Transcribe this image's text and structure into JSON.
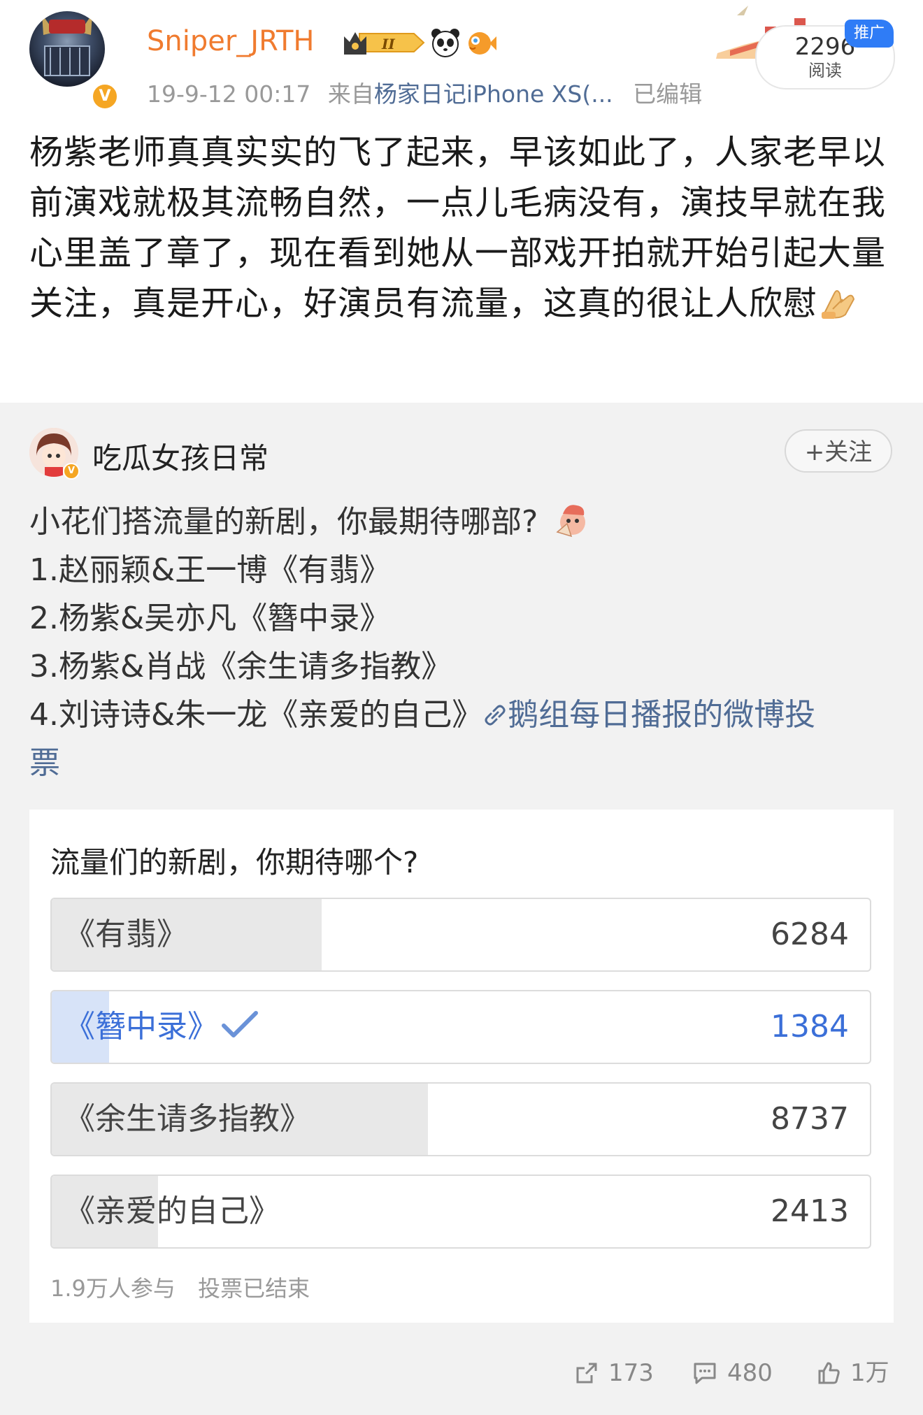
{
  "post": {
    "username": "Sniper_JRTH",
    "timestamp": "19-9-12 00:17",
    "source_prefix": "来自",
    "source": "杨家日记iPhone XS(...",
    "edited": "已编辑",
    "read_count": "2296",
    "read_label": "阅读",
    "promo_label": "推广",
    "level_badge": "II",
    "text": "杨紫老师真真实实的飞了起来，早该如此了，人家老早以前演戏就极其流畅自然，一点儿毛病没有，演技早就在我心里盖了章了，现在看到她从一部戏开拍就开始引起大量关注，真是开心，好演员有流量，这真的很让人欣慰",
    "icons": [
      "crown-level-badge-icon",
      "panda-icon",
      "pufferfish-icon",
      "folded-hands-emoji-icon",
      "verified-v-icon"
    ]
  },
  "repost": {
    "username": "吃瓜女孩日常",
    "follow_label": "+关注",
    "lines": [
      "小花们搭流量的新剧，你最期待哪部?",
      "1.赵丽颖&王一博《有翡》",
      "2.杨紫&吴亦凡《簪中录》",
      "3.杨紫&肖战《余生请多指教》",
      "4.刘诗诗&朱一龙《亲爱的自己》"
    ],
    "link_text_1": "鹅组每日播报的微博投",
    "link_text_2": "票"
  },
  "poll": {
    "title": "流量们的新剧，你期待哪个?",
    "options": [
      {
        "label": "《有翡》",
        "count": "6284",
        "fraction": 0.33,
        "selected": false
      },
      {
        "label": "《簪中录》",
        "count": "1384",
        "fraction": 0.07,
        "selected": true
      },
      {
        "label": "《余生请多指教》",
        "count": "8737",
        "fraction": 0.46,
        "selected": false
      },
      {
        "label": "《亲爱的自己》",
        "count": "2413",
        "fraction": 0.13,
        "selected": false
      }
    ],
    "participants": "1.9万人参与",
    "status": "投票已结束"
  },
  "actions": {
    "repost_count": "173",
    "comment_count": "480",
    "like_count": "1万"
  },
  "colors": {
    "username": "#f07b2f",
    "link": "#506c95",
    "selected": "#3b6fd8",
    "promo": "#2f7cf6"
  }
}
